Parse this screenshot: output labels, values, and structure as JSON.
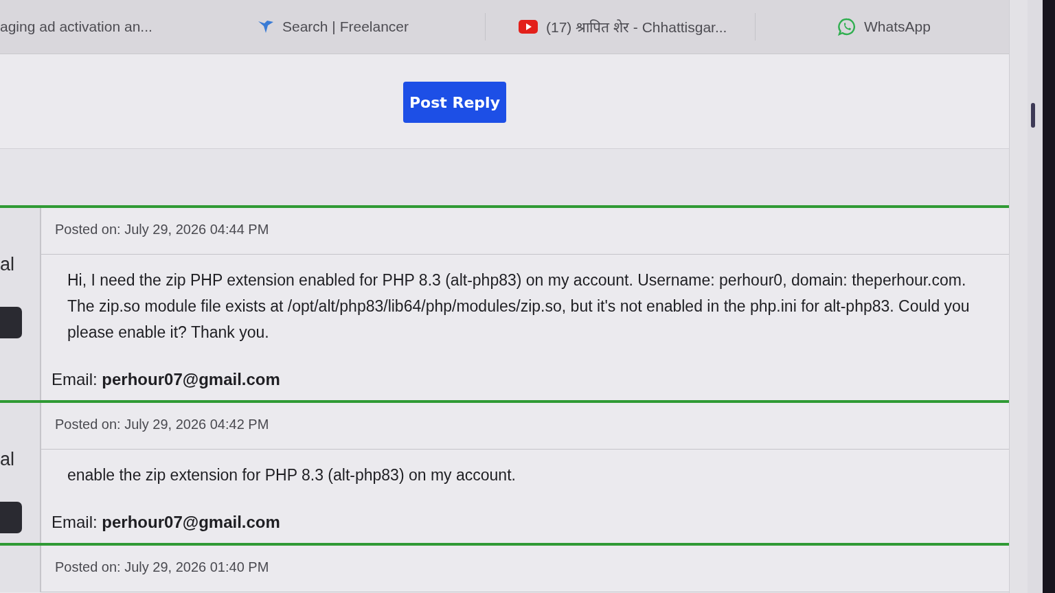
{
  "bookmarks_bar": {
    "items": [
      {
        "kind": "text",
        "label": "aging ad activation an..."
      },
      {
        "kind": "bird",
        "label": "Search | Freelancer"
      },
      {
        "kind": "video",
        "label": "(17) श्रापित शेर - Chhattisgar..."
      },
      {
        "kind": "chat",
        "label": "WhatsApp"
      }
    ]
  },
  "post_reply_button": {
    "label": "Post Reply"
  },
  "posts": [
    {
      "side_label": "al",
      "has_badge": true,
      "posted_on": "Posted on: July 29, 2026 04:44 PM",
      "message": "Hi, I need the zip PHP extension enabled for PHP 8.3 (alt-php83) on my account. Username: perhour0, domain: theperhour.com. The zip.so module file exists at /opt/alt/php83/lib64/php/modules/zip.so, but it's not enabled in the php.ini for alt-php83. Could you please enable it? Thank you.",
      "email": "Email: **perhour07@gmail.com**"
    },
    {
      "side_label": "al",
      "has_badge": true,
      "posted_on": "Posted on: July 29, 2026 04:42 PM",
      "message": "enable the zip extension for PHP 8.3 (alt-php83) on my account.",
      "email": "Email: **perhour07@gmail.com**"
    },
    {
      "has_badge": false,
      "posted_on": "Posted on: July 29, 2026 01:40 PM"
    }
  ]
}
